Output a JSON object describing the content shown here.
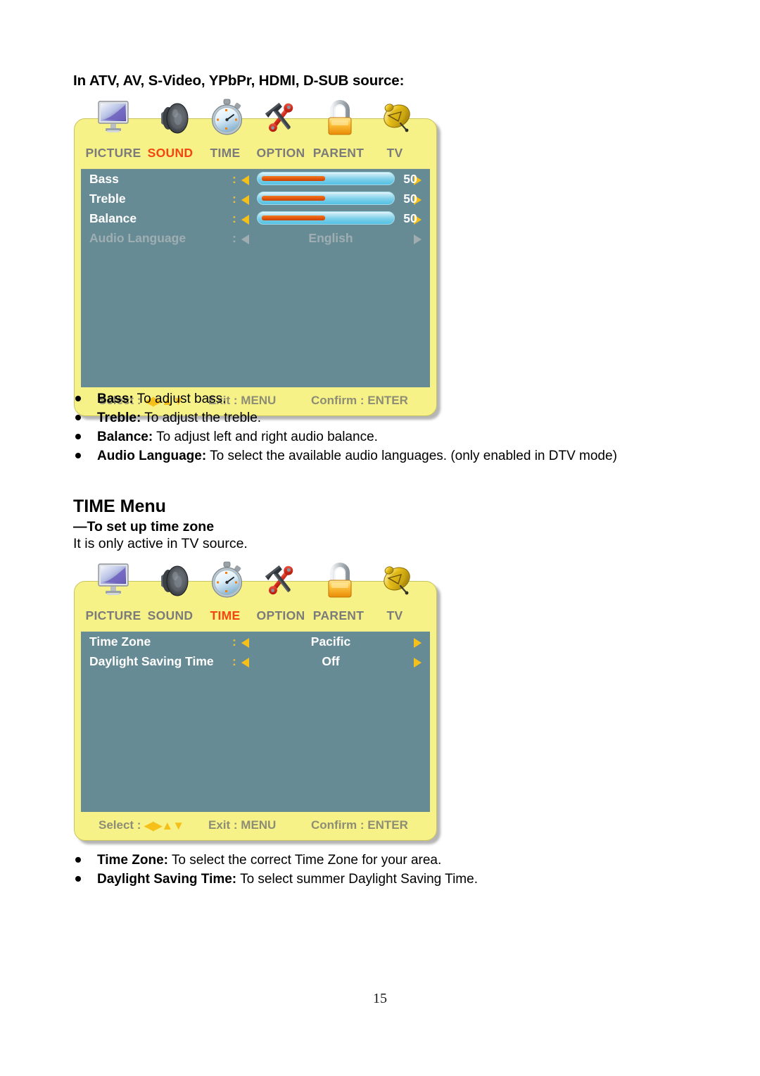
{
  "page": {
    "number": "15"
  },
  "section_one": {
    "heading": "In ATV, AV, S-Video, YPbPr, HDMI, D-SUB source:",
    "osd": {
      "tabs": [
        {
          "label": "PICTURE",
          "icon": "monitor-icon",
          "active": false
        },
        {
          "label": "SOUND",
          "icon": "speaker-icon",
          "active": true
        },
        {
          "label": "TIME",
          "icon": "stopwatch-icon",
          "active": false
        },
        {
          "label": "OPTION",
          "icon": "hammer-wrench-icon",
          "active": false
        },
        {
          "label": "PARENT",
          "icon": "padlock-icon",
          "active": false
        },
        {
          "label": "TV",
          "icon": "satellite-dish-icon",
          "active": false
        }
      ],
      "rows": [
        {
          "label": "Bass",
          "colon": ":",
          "type": "slider",
          "value": "50",
          "fill_percent": 50,
          "dim": false
        },
        {
          "label": "Treble",
          "colon": ":",
          "type": "slider",
          "value": "50",
          "fill_percent": 50,
          "dim": false
        },
        {
          "label": "Balance",
          "colon": ":",
          "type": "slider",
          "value": "50",
          "fill_percent": 50,
          "dim": false
        },
        {
          "label": "Audio Language",
          "colon": ":",
          "type": "option",
          "value": "English",
          "dim": true
        }
      ],
      "footer": {
        "select_label": "Select :",
        "select_arrows": "◀▶▲▼",
        "exit_label": "Exit : MENU",
        "confirm_label": "Confirm : ENTER"
      }
    },
    "bullets": [
      {
        "term": "Bass:",
        "desc": " To adjust bass."
      },
      {
        "term": "Treble:",
        "desc": " To adjust the treble."
      },
      {
        "term": "Balance:",
        "desc": " To adjust left and right audio balance."
      },
      {
        "term": "Audio Language:",
        "desc": " To select the available audio languages. (only enabled in DTV mode)"
      }
    ]
  },
  "section_two": {
    "title": "TIME Menu",
    "subtitle": "—To set up time zone",
    "note": "It is only active in TV source.",
    "osd": {
      "tabs": [
        {
          "label": "PICTURE",
          "icon": "monitor-icon",
          "active": false
        },
        {
          "label": "SOUND",
          "icon": "speaker-icon",
          "active": false
        },
        {
          "label": "TIME",
          "icon": "stopwatch-icon",
          "active": true
        },
        {
          "label": "OPTION",
          "icon": "hammer-wrench-icon",
          "active": false
        },
        {
          "label": "PARENT",
          "icon": "padlock-icon",
          "active": false
        },
        {
          "label": "TV",
          "icon": "satellite-dish-icon",
          "active": false
        }
      ],
      "rows": [
        {
          "label": "Time Zone",
          "colon": ":",
          "type": "option",
          "value": "Pacific",
          "dim": false
        },
        {
          "label": "Daylight Saving Time",
          "colon": ":",
          "type": "option",
          "value": "Off",
          "dim": false
        }
      ],
      "footer": {
        "select_label": "Select :",
        "select_arrows": "◀▶▲▼",
        "exit_label": "Exit : MENU",
        "confirm_label": "Confirm : ENTER"
      }
    },
    "bullets": [
      {
        "term": "Time Zone:",
        "desc": " To select the correct Time Zone for your area."
      },
      {
        "term": "Daylight Saving Time:",
        "desc": " To select summer Daylight Saving Time."
      }
    ]
  },
  "colors": {
    "osd_frame": "#f7f287",
    "osd_panel": "#678b95",
    "tab_inactive": "#7b7b7b",
    "tab_active": "#f4470f",
    "arrow": "#f5c019",
    "slider_fill": "#e2560c",
    "footer_text": "#8d8d76"
  }
}
